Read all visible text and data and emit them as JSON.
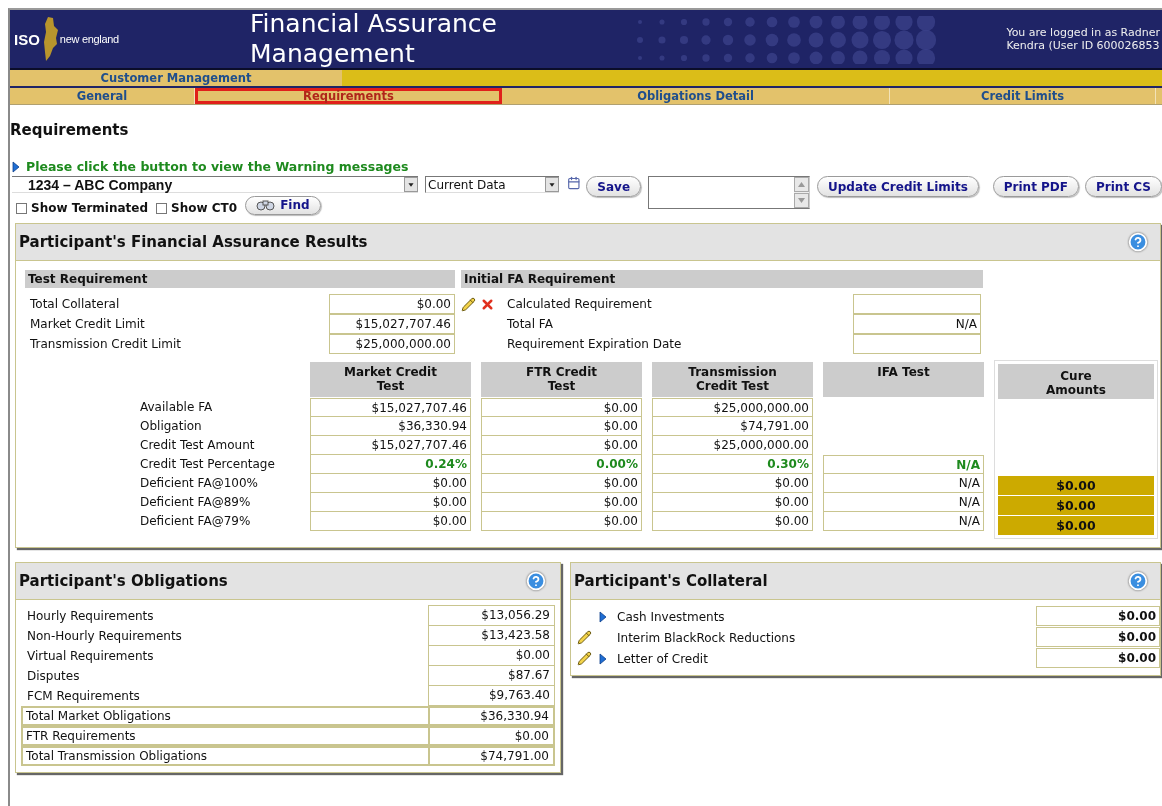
{
  "header": {
    "logo_mark": "ISO",
    "logo_text": "new england",
    "title": "Financial Assurance Management",
    "user_info": [
      "You are logged in as Radner",
      "Kendra (User ID 600026853"
    ]
  },
  "menu": {
    "label": "Customer Management"
  },
  "tabs": [
    {
      "label": "General",
      "selected": false
    },
    {
      "label": "Requirements",
      "selected": true
    },
    {
      "label": "Obligations Detail",
      "selected": false
    },
    {
      "label": "Credit Limits",
      "selected": false
    }
  ],
  "page_title": "Requirements",
  "warning_link": "Please click the button to view the Warning messages",
  "toolbar": {
    "participant": "1234 – ABC Company",
    "data_view": "Current Data",
    "save": "Save",
    "buttons": [
      "Update Credit Limits",
      "Print PDF",
      "Print CS"
    ],
    "filters": [
      {
        "label": "Show Terminated",
        "checked": false
      },
      {
        "label": "Show CT0",
        "checked": false
      }
    ],
    "find": "Find"
  },
  "results": {
    "title": "Participant's Financial Assurance Results",
    "test_requirement": {
      "title": "Test Requirement",
      "rows": [
        {
          "label": "Total Collateral",
          "value": "$0.00"
        },
        {
          "label": "Market Credit Limit",
          "value": "$15,027,707.46"
        },
        {
          "label": "Transmission Credit Limit",
          "value": "$25,000,000.00"
        }
      ]
    },
    "initial_fa": {
      "title": "Initial FA Requirement",
      "rows": [
        {
          "label": "Calculated Requirement",
          "editable": true
        },
        {
          "label": "Total FA",
          "value": "N/A",
          "editable": false
        },
        {
          "label": "Requirement Expiration Date",
          "editable": false
        }
      ]
    },
    "row_labels": [
      {
        "label": "Available FA",
        "kind": "amount"
      },
      {
        "label": "Obligation",
        "kind": "amount"
      },
      {
        "label": "Credit Test Amount",
        "kind": "amount"
      },
      {
        "label": "Credit Test Percentage",
        "kind": "percentage"
      },
      {
        "label": "Deficient FA@100%",
        "kind": "amount"
      },
      {
        "label": "Deficient FA@89%",
        "kind": "amount"
      },
      {
        "label": "Deficient FA@79%",
        "kind": "amount"
      }
    ],
    "columns": [
      {
        "title": "Market Credit Test",
        "values": [
          "$15,027,707.46",
          "$36,330.94",
          "$15,027,707.46",
          "0.24%",
          "$0.00",
          "$0.00",
          "$0.00"
        ]
      },
      {
        "title": "FTR Credit Test",
        "values": [
          "$0.00",
          "$0.00",
          "$0.00",
          "0.00%",
          "$0.00",
          "$0.00",
          "$0.00"
        ]
      },
      {
        "title": "Transmission Credit Test",
        "values": [
          "$25,000,000.00",
          "$74,791.00",
          "$25,000,000.00",
          "0.30%",
          "$0.00",
          "$0.00",
          "$0.00"
        ]
      },
      {
        "title": "IFA Test",
        "values": [
          "N/A",
          "N/A",
          "N/A",
          "N/A"
        ]
      }
    ],
    "cure": {
      "title": "Cure Amounts",
      "values": [
        "$0.00",
        "$0.00",
        "$0.00"
      ]
    }
  },
  "obligations": {
    "title": "Participant's Obligations",
    "rows": [
      {
        "label": "Hourly Requirements",
        "value": "$13,056.29",
        "kind": "item"
      },
      {
        "label": "Non-Hourly Requirements",
        "value": "$13,423.58",
        "kind": "item"
      },
      {
        "label": "Virtual Requirements",
        "value": "$0.00",
        "kind": "item"
      },
      {
        "label": "Disputes",
        "value": "$87.67",
        "kind": "item"
      },
      {
        "label": "FCM Requirements",
        "value": "$9,763.40",
        "kind": "item"
      },
      {
        "label": "Total Market Obligations",
        "value": "$36,330.94",
        "kind": "total"
      },
      {
        "label": "FTR Requirements",
        "value": "$0.00",
        "kind": "total"
      },
      {
        "label": "Total Transmission Obligations",
        "value": "$74,791.00",
        "kind": "total"
      }
    ]
  },
  "collateral": {
    "title": "Participant's Collateral",
    "rows": [
      {
        "label": "Cash Investments",
        "value": "$0.00",
        "editable": false,
        "expandable": true
      },
      {
        "label": "Interim BlackRock Reductions",
        "value": "$0.00",
        "editable": true,
        "expandable": false
      },
      {
        "label": "Letter of Credit",
        "value": "$0.00",
        "editable": true,
        "expandable": true
      }
    ]
  }
}
